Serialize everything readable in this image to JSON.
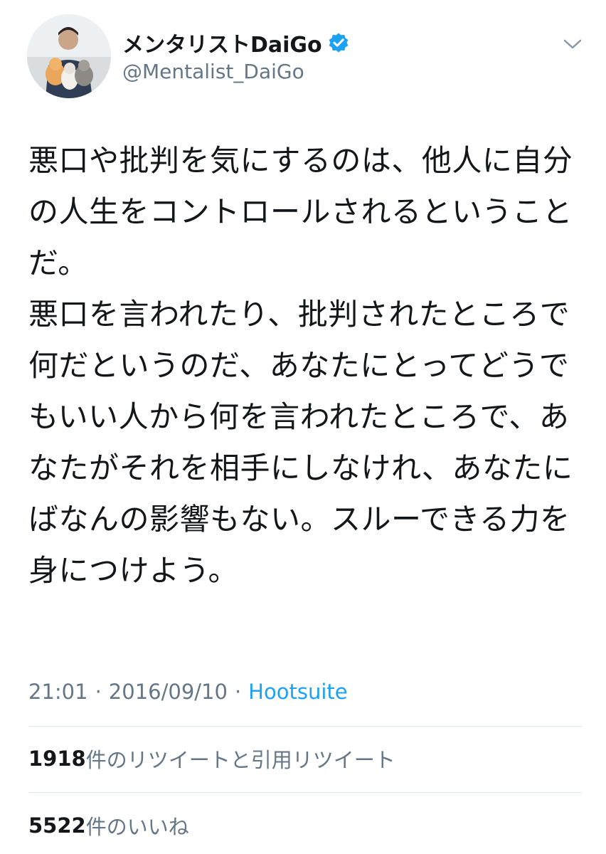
{
  "user": {
    "display_name": "メンタリストDaiGo",
    "handle": "@Mentalist_DaiGo",
    "verified_icon": "verified-badge-icon",
    "avatar_icon": "profile-avatar",
    "menu_icon": "chevron-down-icon"
  },
  "tweet": {
    "text": "悪口や批判を気にするのは、他人に自分の人生をコントロールされるということだ。\n悪口を言われたり、批判されたところで何だというのだ、あなたにとってどうでもいい人から何を言われたところで、あなたがそれを相手にしなけれ、あなたにばなんの影響もない。スルーできる力を身につけよう。"
  },
  "meta": {
    "time": "21:01",
    "separator": "·",
    "date": "2016/09/10",
    "source": "Hootsuite"
  },
  "stats": {
    "retweets": {
      "count": "1918",
      "label": "件のリツイートと引用リツイート"
    },
    "likes": {
      "count": "5522",
      "label": "件のいいね"
    }
  },
  "colors": {
    "text": "#14171a",
    "secondary": "#657786",
    "accent": "#1da1f2",
    "divider": "#e1e8ed"
  }
}
